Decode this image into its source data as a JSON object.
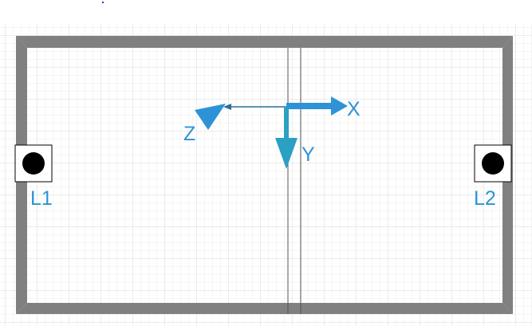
{
  "colors": {
    "background": "#ffffff",
    "grid_major": "#d8d8d8",
    "grid_minor": "#eeeeee",
    "frame": "#808080",
    "axis_blue": "#2e93d6",
    "axis_y": "#2aa0c2",
    "z_line": "#2b6f96",
    "label": "#2e93d6",
    "marker_dot": "#000000",
    "stray_dot": "#1a3fbf"
  },
  "icons": {
    "l1": "black-dot-marker-icon",
    "l2": "black-dot-marker-icon"
  },
  "axes": {
    "x_label": "X",
    "y_label": "Y",
    "z_label": "Z"
  },
  "markers": {
    "left_label": "L1",
    "right_label": "L2"
  }
}
